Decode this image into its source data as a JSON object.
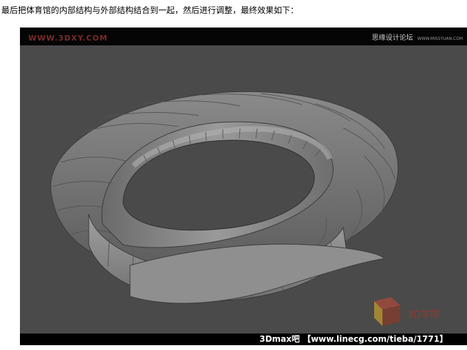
{
  "caption": "最后把体育馆的内部结构与外部结构结合到一起，然后进行调整，最终效果如下：",
  "watermark_left": "WWW.3DXY.COM",
  "watermark_right": "思缘设计论坛",
  "watermark_right_small": "WWW.MISSYUAN.COM",
  "footer": "3Dmax吧 【www.linecg.com/tieba/1771】",
  "logo_text": "3D学院",
  "colors": {
    "viewport_bg": "#4a4a4a",
    "model_face": "#7a7a7a",
    "watermark_red": "#7a2a2a"
  }
}
